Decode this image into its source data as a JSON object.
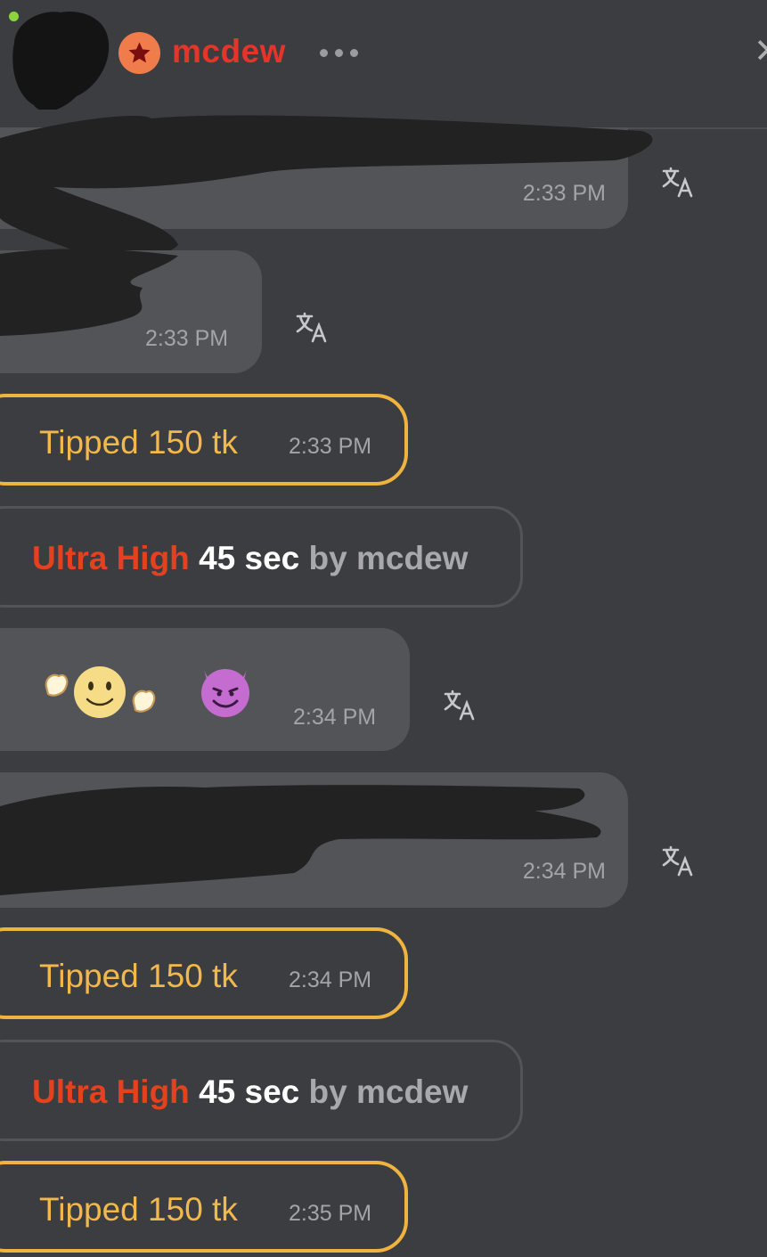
{
  "header": {
    "username": "mcdew",
    "online": true,
    "rank_icon": "star-icon",
    "more_icon": "more-horizontal-icon",
    "close_icon": "close-icon"
  },
  "colors": {
    "background": "#3c3d41",
    "bubble": "#535458",
    "username": "#e5342a",
    "tip_border": "#efb340",
    "tip_text": "#f2b84a",
    "ultra_level": "#e5411e"
  },
  "messages": [
    {
      "type": "text",
      "time": "2:33 PM",
      "translate_icon": "translate-icon"
    },
    {
      "type": "text",
      "time": "2:33 PM",
      "translate_icon": "translate-icon"
    },
    {
      "type": "tip",
      "label": "Tipped 150 tk",
      "time": "2:33 PM"
    },
    {
      "type": "control",
      "level": "Ultra High",
      "duration": "45 sec",
      "by": "by mcdew"
    },
    {
      "type": "emoji",
      "emojis": [
        "🙌",
        "🙂",
        "😈"
      ],
      "time": "2:34 PM",
      "translate_icon": "translate-icon"
    },
    {
      "type": "text",
      "time": "2:34 PM",
      "translate_icon": "translate-icon"
    },
    {
      "type": "tip",
      "label": "Tipped 150 tk",
      "time": "2:34 PM"
    },
    {
      "type": "control",
      "level": "Ultra High",
      "duration": "45 sec",
      "by": "by mcdew"
    },
    {
      "type": "tip",
      "label": "Tipped 150 tk",
      "time": "2:35 PM"
    }
  ]
}
